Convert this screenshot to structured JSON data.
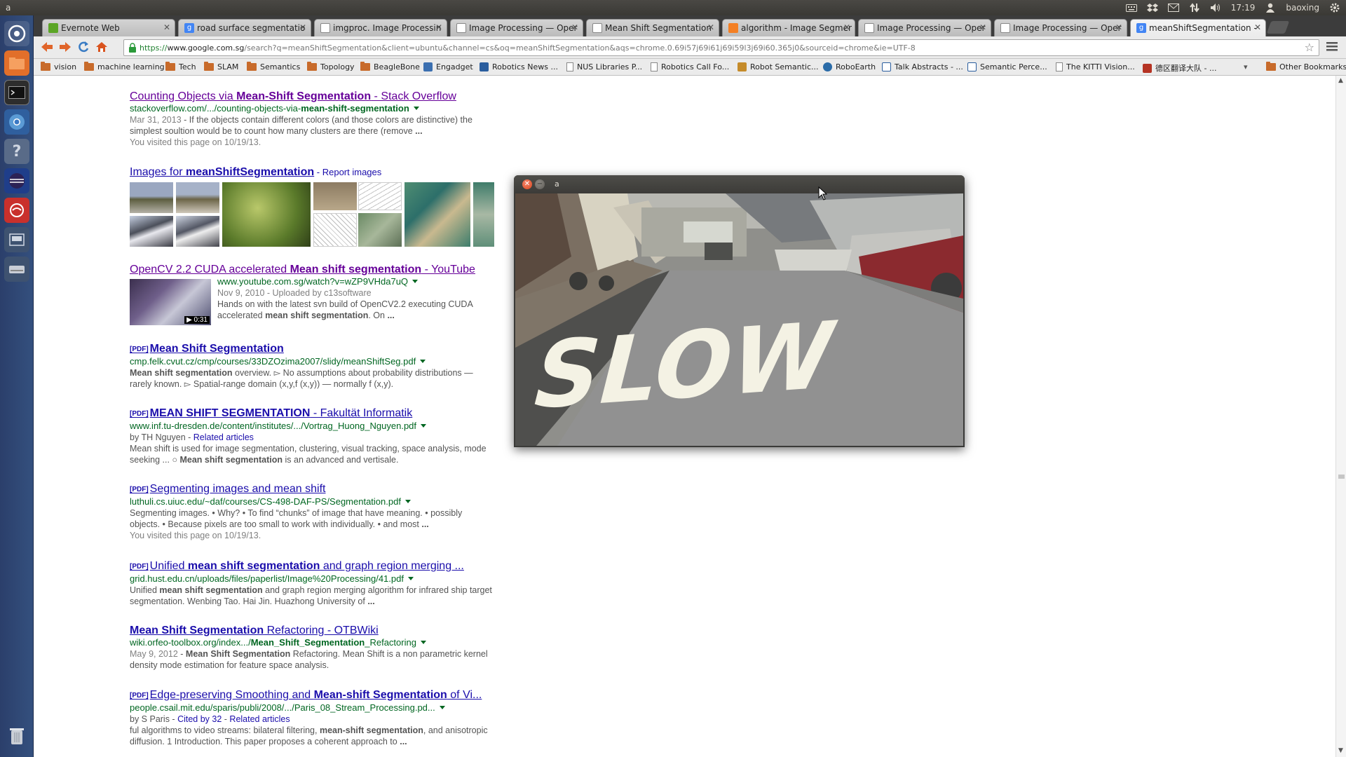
{
  "top_panel": {
    "window_title": "a",
    "clock": "17:19",
    "user": "baoxing",
    "tray_icons": [
      "keyboard-icon",
      "dropbox-icon",
      "mail-icon",
      "network-icon",
      "volume-icon",
      "user-icon",
      "gear-icon"
    ]
  },
  "launcher": {
    "items": [
      "ubuntu-dash-icon",
      "files-icon",
      "terminal-icon",
      "chromium-icon",
      "help-icon",
      "eclipse-icon",
      "document-viewer-icon",
      "workspace-icon",
      "drive-icon",
      "trash-icon"
    ]
  },
  "tabs": [
    {
      "label": "Evernote Web",
      "color": "#5ba525"
    },
    {
      "label": "road surface segmentatio",
      "color": "#4285f4"
    },
    {
      "label": "imgproc. Image Processin",
      "color": "#ffffff"
    },
    {
      "label": "Image Processing — Oper",
      "color": "#ffffff"
    },
    {
      "label": "Mean Shift Segmentation",
      "color": "#ffffff"
    },
    {
      "label": "algorithm - Image Segmer",
      "color": "#f48024"
    },
    {
      "label": "Image Processing — Oper",
      "color": "#ffffff"
    },
    {
      "label": "Image Processing — Oper",
      "color": "#ffffff"
    },
    {
      "label": "meanShiftSegmentation -",
      "color": "#4285f4"
    }
  ],
  "toolbar": {
    "url_scheme": "https://",
    "url_host": "www.google.com.sg",
    "url_rest": "/search?q=meanShiftSegmentation&client=ubuntu&channel=cs&oq=meanShiftSegmentation&aqs=chrome.0.69i57j69i61j69i59l3j69i60.365j0&sourceid=chrome&ie=UTF-8"
  },
  "bookmarks": [
    {
      "label": "vision",
      "type": "folder"
    },
    {
      "label": "machine learning",
      "type": "folder"
    },
    {
      "label": "Tech",
      "type": "folder"
    },
    {
      "label": "SLAM",
      "type": "folder"
    },
    {
      "label": "Semantics",
      "type": "folder"
    },
    {
      "label": "Topology",
      "type": "folder"
    },
    {
      "label": "BeagleBone",
      "type": "folder"
    },
    {
      "label": "Engadget",
      "type": "site"
    },
    {
      "label": "Robotics News ...",
      "type": "site"
    },
    {
      "label": "NUS Libraries P...",
      "type": "page"
    },
    {
      "label": "Robotics Call Fo...",
      "type": "page"
    },
    {
      "label": "Robot Semantic...",
      "type": "site"
    },
    {
      "label": "RoboEarth",
      "type": "site"
    },
    {
      "label": "Talk Abstracts - ...",
      "type": "site"
    },
    {
      "label": "Semantic Perce...",
      "type": "site"
    },
    {
      "label": "The KITTI Vision...",
      "type": "page"
    },
    {
      "label": "德区翻译大队 - ...",
      "type": "site"
    },
    {
      "label": "Other Bookmarks",
      "type": "folder"
    }
  ],
  "results": {
    "r1": {
      "title_pre": "Counting Objects via ",
      "title_bold": "Mean-Shift Segmentation",
      "title_post": " - Stack Overflow",
      "url_pre": "stackoverflow.com/.../counting-objects-via-",
      "url_bold": "mean-shift-segmentation",
      "date": "Mar 31, 2013",
      "snippet": " - If the objects contain different colors (and those colors are distinctive) the simplest soultion would be to count how many clusters are there (remove ",
      "ellipsis": "...",
      "visited": "You visited this page on 10/19/13."
    },
    "images": {
      "title_pre": "Images for ",
      "title_bold": "meanShiftSegmentation",
      "report": " - Report images"
    },
    "r2": {
      "title_pre": "OpenCV 2.2 CUDA accelerated ",
      "title_bold": "Mean shift segmentation",
      "title_post": " - YouTube",
      "url": "www.youtube.com.sg/watch?v=wZP9VHda7uQ",
      "meta": "Nov 9, 2010 - Uploaded by c13software",
      "snippet_pre": "Hands on with the latest svn build of OpenCV2.2 executing CUDA accelerated ",
      "snippet_bold": "mean shift segmentation",
      "snippet_post": ". On ",
      "ellipsis": "...",
      "duration": "▶ 0:31"
    },
    "r3": {
      "pdf": "[PDF]",
      "title": "Mean Shift Segmentation",
      "url": "cmp.felk.cvut.cz/cmp/courses/33DZOzima2007/slidy/meanShiftSeg.pdf",
      "snippet_bold": "Mean shift segmentation",
      "snippet": " overview. ▻ No assumptions about probability distributions — rarely known. ▻ Spatial-range domain (x,y,f (x,y)) — normally f (x,y)."
    },
    "r4": {
      "pdf": "[PDF]",
      "title_bold": "MEAN SHIFT SEGMENTATION",
      "title_post": " - Fakultät Informatik",
      "url": "www.inf.tu-dresden.de/content/institutes/.../Vortrag_Huong_Nguyen.pdf",
      "by": "by TH Nguyen - ",
      "related": "Related articles",
      "snippet_pre": "Mean shift is used for image segmentation, clustering, visual tracking, space analysis, mode seeking ... ○ ",
      "snippet_bold": "Mean shift segmentation",
      "snippet_post": " is an advanced and vertisale."
    },
    "r5": {
      "pdf": "[PDF]",
      "title": "Segmenting images and mean shift",
      "url": "luthuli.cs.uiuc.edu/~daf/courses/CS-498-DAF-PS/Segmentation.pdf",
      "snippet": "Segmenting images. • Why? • To find “chunks” of image that have meaning. • possibly objects. • Because pixels are too small to work with individually. • and most ",
      "ellipsis": "...",
      "visited": "You visited this page on 10/19/13."
    },
    "r6": {
      "pdf": "[PDF]",
      "title_pre": "Unified ",
      "title_bold": "mean shift segmentation",
      "title_post": " and graph region merging ...",
      "url": "grid.hust.edu.cn/uploads/files/paperlist/Image%20Processing/41.pdf",
      "snippet_pre": "Unified ",
      "snippet_bold": "mean shift segmentation",
      "snippet_post": " and graph region merging algorithm for infrared ship target segmentation. Wenbing Tao. Hai Jin. Huazhong University of ",
      "ellipsis": "..."
    },
    "r7": {
      "title_bold": "Mean Shift Segmentation",
      "title_post": " Refactoring - OTBWiki",
      "url_pre": "wiki.orfeo-toolbox.org/index.../",
      "url_bold": "Mean_Shift_Segmentation",
      "url_post": "_Refactoring",
      "date": "May 9, 2012",
      "snippet_pre": " - ",
      "snippet_bold": "Mean Shift Segmentation",
      "snippet_post": " Refactoring. Mean Shift is a non parametric kernel density mode estimation for feature space analysis."
    },
    "r8": {
      "pdf": "[PDF]",
      "title_pre": "Edge-preserving Smoothing and ",
      "title_bold": "Mean-shift Segmentation",
      "title_post": " of Vi...",
      "url": "people.csail.mit.edu/sparis/publi/2008/.../Paris_08_Stream_Processing.pd...",
      "by": "by S Paris - ",
      "cited": "Cited by 32",
      "sep": " - ",
      "related": "Related articles",
      "snippet_pre": "ful algorithms to video streams: bilateral filtering, ",
      "snippet_bold": "mean-shift segmentation",
      "snippet_post": ", and anisotropic diffusion. 1 Introduction. This paper proposes a coherent approach to ",
      "ellipsis": "..."
    }
  },
  "floating_window": {
    "title": "a",
    "close_glyph": "✕",
    "min_glyph": "−",
    "road_text": "SLOW"
  },
  "colors": {
    "link": "#1a0dab",
    "visited": "#660099",
    "url_green": "#006621"
  }
}
